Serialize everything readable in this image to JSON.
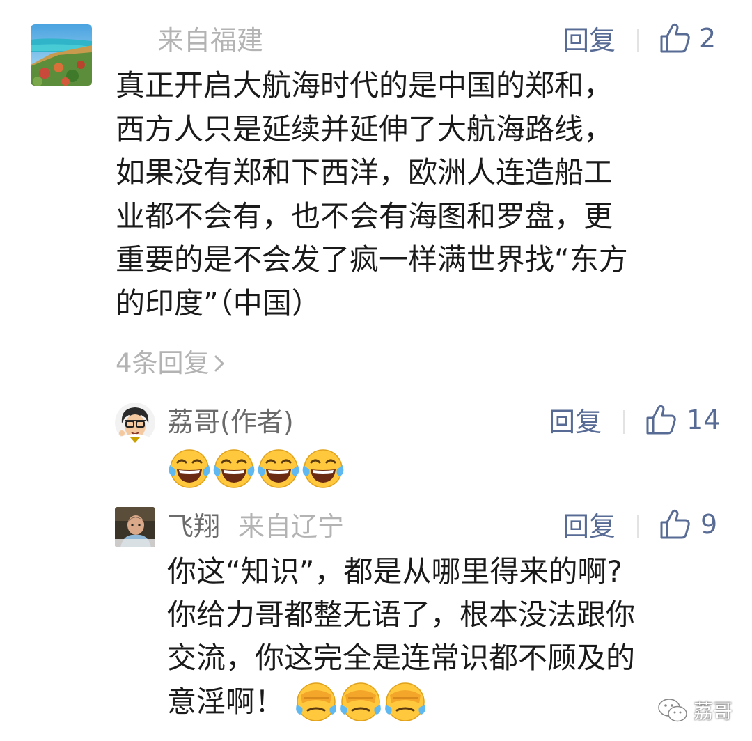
{
  "main_comment": {
    "location": "来自福建",
    "reply_label": "回复",
    "like_count": "2",
    "text_lines": [
      "真正开启大航海时代的是中国的郑和，",
      "西方人只是延续并延伸了大航海路线，",
      "如果没有郑和下西洋，欧洲人连造船工",
      "业都不会有，也不会有海图和罗盘，更",
      "重要的是不会发了疯一样满世界找“东方",
      "的印度”（中国）"
    ],
    "replies_link": "4条回复"
  },
  "replies": [
    {
      "name": "荔哥(作者)",
      "reply_label": "回复",
      "like_count": "14",
      "emoji": "laughing-crying-emoji"
    },
    {
      "name": "飞翔",
      "location": "来自辽宁",
      "reply_label": "回复",
      "like_count": "9",
      "text_lines": [
        "你这“知识”，都是从哪里得来的啊?",
        "你给力哥都整无语了，根本没法跟你",
        "交流，你这完全是连常识都不顾及的",
        "意淫啊！"
      ],
      "emoji": "facepalm-crying-emoji"
    }
  ],
  "watermark": {
    "label": "荔哥"
  },
  "colors": {
    "link_blue": "#576b95",
    "muted_gray": "#b3b3b3",
    "text": "#1a1a1a",
    "emoji_yellow": "#ffc83d"
  }
}
